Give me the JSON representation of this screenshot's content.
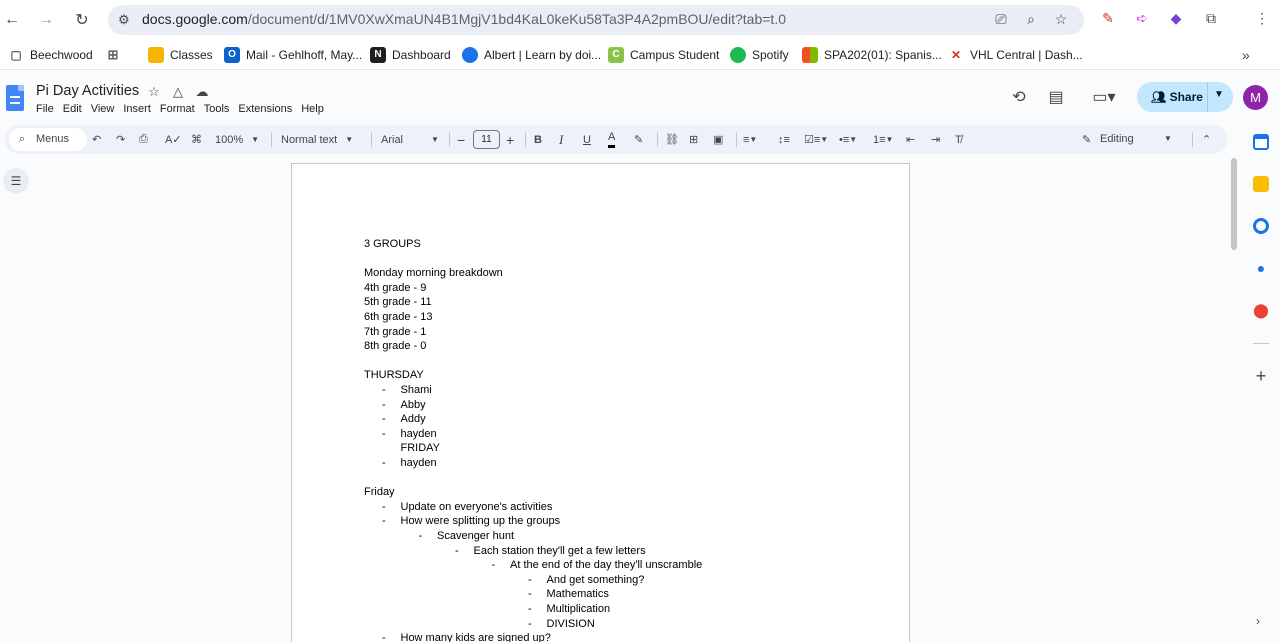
{
  "browser": {
    "url_host": "docs.google.com",
    "url_path": "/document/d/1MV0XwXmaUN4B1MgjV1bd4KaL0keKu58Ta3P4A2pmBOU/edit?tab=t.0"
  },
  "bookmarks": [
    {
      "label": "Beechwood",
      "color": "#5f6368"
    },
    {
      "label": "Classes",
      "color": "#f6b400"
    },
    {
      "label": "Mail - Gehlhoff, May...",
      "color": "#0a64c9"
    },
    {
      "label": "Dashboard",
      "color": "#1f1f1f"
    },
    {
      "label": "Albert | Learn by doi...",
      "color": "#1a73e8"
    },
    {
      "label": "Campus Student",
      "color": "#8bc34a"
    },
    {
      "label": "Spotify",
      "color": "#1db954"
    },
    {
      "label": "SPA202(01): Spanis...",
      "color": "#f25022"
    },
    {
      "label": "VHL Central | Dash...",
      "color": "#d93025"
    }
  ],
  "doc": {
    "title": "Pi Day Activities",
    "menus": [
      "File",
      "Edit",
      "View",
      "Insert",
      "Format",
      "Tools",
      "Extensions",
      "Help"
    ],
    "share_label": "Share",
    "avatar_initial": "M"
  },
  "toolbar": {
    "menus_label": "Menus",
    "zoom": "100%",
    "style": "Normal text",
    "font": "Arial",
    "font_size": "11",
    "editing_label": "Editing"
  },
  "content": [
    {
      "text": "3 GROUPS",
      "indent": 0,
      "bullet": false
    },
    {
      "text": "",
      "indent": 0,
      "bullet": false
    },
    {
      "text": " Monday morning breakdown",
      "indent": 0,
      "bullet": false
    },
    {
      "text": "4th grade - 9",
      "indent": 0,
      "bullet": false
    },
    {
      "text": "5th grade - 11",
      "indent": 0,
      "bullet": false
    },
    {
      "text": "6th grade - 13",
      "indent": 0,
      "bullet": false
    },
    {
      "text": "7th grade - 1",
      "indent": 0,
      "bullet": false
    },
    {
      "text": "8th grade - 0",
      "indent": 0,
      "bullet": false
    },
    {
      "text": "",
      "indent": 0,
      "bullet": false
    },
    {
      "text": "THURSDAY",
      "indent": 0,
      "bullet": false
    },
    {
      "text": "Shami",
      "indent": 1,
      "bullet": true
    },
    {
      "text": "Abby",
      "indent": 1,
      "bullet": true
    },
    {
      "text": "Addy",
      "indent": 1,
      "bullet": true
    },
    {
      "text": "hayden",
      "indent": 1,
      "bullet": true
    },
    {
      "text": "FRIDAY",
      "indent": 1,
      "bullet": false
    },
    {
      "text": "hayden",
      "indent": 1,
      "bullet": true
    },
    {
      "text": "",
      "indent": 0,
      "bullet": false
    },
    {
      "text": "Friday",
      "indent": 0,
      "bullet": false
    },
    {
      "text": "Update on everyone's activities",
      "indent": 1,
      "bullet": true
    },
    {
      "text": "How were splitting up the groups",
      "indent": 1,
      "bullet": true
    },
    {
      "text": "Scavenger hunt",
      "indent": 2,
      "bullet": true
    },
    {
      "text": "Each station they'll get a few letters",
      "indent": 3,
      "bullet": true
    },
    {
      "text": "At the end of the day they'll unscramble",
      "indent": 4,
      "bullet": true
    },
    {
      "text": "And get something?",
      "indent": 5,
      "bullet": true
    },
    {
      "text": "Mathematics",
      "indent": 5,
      "bullet": true
    },
    {
      "text": "Multiplication",
      "indent": 5,
      "bullet": true
    },
    {
      "text": "DIVISION",
      "indent": 5,
      "bullet": true
    },
    {
      "text": "How many kids are signed up?",
      "indent": 1,
      "bullet": true
    }
  ],
  "colors": {
    "accent": "#1a73e8",
    "share_bg": "#c2e7ff",
    "toolbar_bg": "#edf2fa",
    "avatar": "#8e24aa"
  }
}
